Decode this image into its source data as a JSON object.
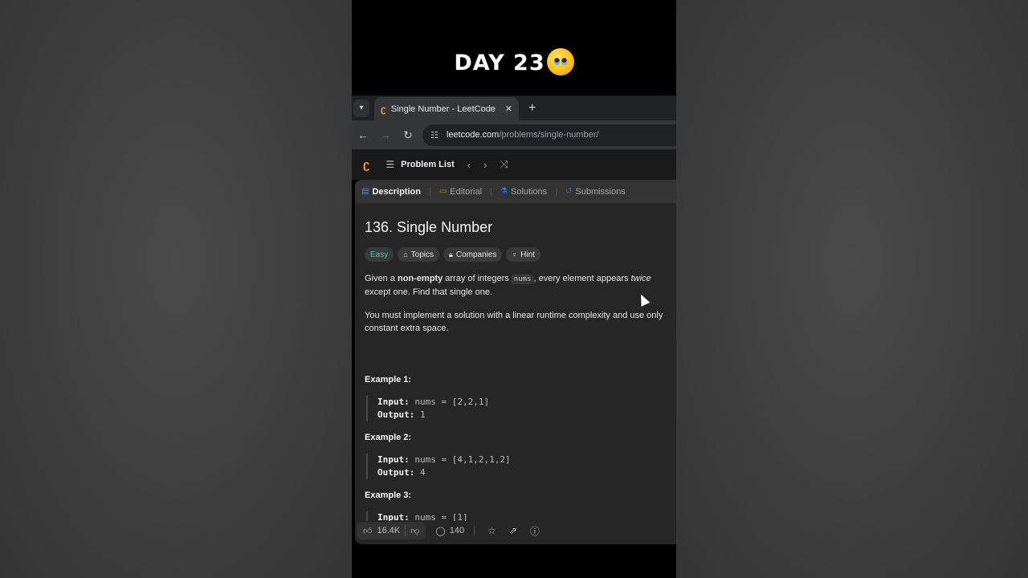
{
  "video": {
    "day_title": "DAY 23"
  },
  "browser": {
    "tab_title": "Single Number - LeetCode",
    "tab_close": "✕",
    "new_tab": "+",
    "url_domain": "leetcode.com",
    "url_path": "/problems/single-number/"
  },
  "lc_nav": {
    "problem_list": "Problem List"
  },
  "tabs": [
    {
      "label": "Description"
    },
    {
      "label": "Editorial"
    },
    {
      "label": "Solutions"
    },
    {
      "label": "Submissions"
    }
  ],
  "problem": {
    "title": "136. Single Number",
    "tags": [
      "Easy",
      "Topics",
      "Companies",
      "Hint"
    ],
    "p1_a": "Given a ",
    "p1_bold": "non-empty",
    "p1_b": " array of integers ",
    "p1_code": "nums",
    "p1_c": ", every element appears ",
    "p1_em": "twice",
    "p1_d": " except one. Find that single one.",
    "p2": "You must implement a solution with a linear runtime complexity and use only constant extra space."
  },
  "examples": [
    {
      "title": "Example 1:",
      "input_label": "Input:",
      "input": "nums = [2,2,1]",
      "output_label": "Output:",
      "output": "1"
    },
    {
      "title": "Example 2:",
      "input_label": "Input:",
      "input": "nums = [4,1,2,1,2]",
      "output_label": "Output:",
      "output": "4"
    },
    {
      "title": "Example 3:",
      "input_label": "Input:",
      "input": "nums = [1]"
    }
  ],
  "footer": {
    "likes": "16.4K",
    "comments": "140"
  },
  "colors": {
    "accent": "#ffa116",
    "easy": "#46c6c2",
    "panel": "#262626"
  }
}
